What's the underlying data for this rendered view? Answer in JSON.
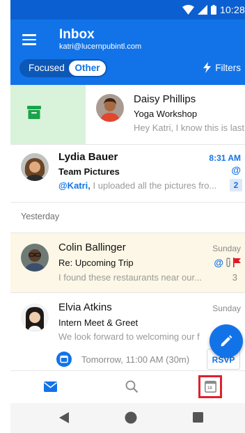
{
  "status": {
    "time": "10:28"
  },
  "header": {
    "title": "Inbox",
    "account": "katri@lucernpubintl.com",
    "tab_focused": "Focused",
    "tab_other": "Other",
    "filters": "Filters"
  },
  "messages": [
    {
      "sender": "Daisy Phillips",
      "subject": "Yoga Workshop",
      "preview": "Hey Katri, I know this is last",
      "time": ""
    },
    {
      "sender": "Lydia Bauer",
      "subject": "Team Pictures",
      "mention": "@Katri,",
      "preview": " I uploaded all the pictures fro...",
      "time": "8:31 AM",
      "mention_icon": "@",
      "count": "2"
    },
    {
      "sender": "Colin Ballinger",
      "subject": "Re: Upcoming Trip",
      "preview": "I found these restaurants near our...",
      "time": "Sunday",
      "count": "3"
    },
    {
      "sender": "Elvia Atkins",
      "subject": "Intern Meet & Greet",
      "preview": "We look forward to welcoming our f",
      "time": "Sunday",
      "event_time": "Tomorrow, 11:00 AM (30m)",
      "rsvp": "RSVP"
    }
  ],
  "sections": {
    "yesterday": "Yesterday"
  },
  "colors": {
    "primary": "#1273e8",
    "statusbar": "#0b5fd1",
    "archive_green": "#1aa34a",
    "unread_blue": "#1273e8",
    "flag_red": "#e3172b",
    "highlight_row": "#fcf7e6",
    "calendar_highlight": "#e0202c"
  },
  "icons": {
    "archive": "archive-icon",
    "mail": "mail-icon",
    "search": "search-icon",
    "calendar": "calendar-icon",
    "compose": "compose-icon",
    "filters": "lightning-icon"
  },
  "bottom_nav": {
    "calendar_day": "18"
  }
}
